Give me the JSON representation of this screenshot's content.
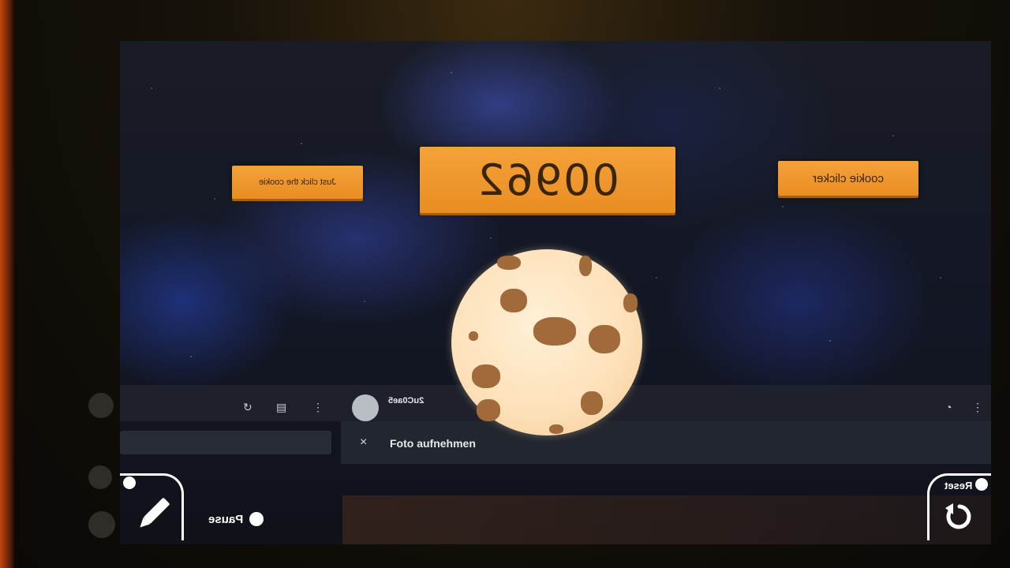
{
  "game": {
    "hint_label": "Just click the cookie",
    "score": "00962",
    "title_label": "cookie clicker",
    "pause_label": "Pause",
    "reset_label": "Reset"
  },
  "overlay": {
    "username": "2uC0ae5",
    "photo_label": "Foto aufnehmen",
    "close_glyph": "×"
  },
  "colors": {
    "accent_orange": "#f0992e",
    "cookie_dough": "#fde0b8",
    "chip": "#a06a3a"
  }
}
